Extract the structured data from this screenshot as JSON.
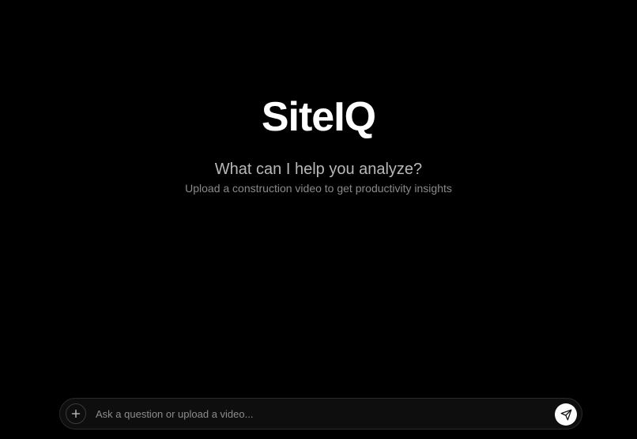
{
  "brand": {
    "name": "SiteIQ"
  },
  "welcome": {
    "headline": "What can I help you analyze?",
    "subline": "Upload a construction video to get productivity insights"
  },
  "composer": {
    "placeholder": "Ask a question or upload a video...",
    "value": "",
    "attach_icon": "plus-icon",
    "send_icon": "send-icon"
  },
  "colors": {
    "background": "#000000",
    "composer_bg": "#0e0e0e",
    "send_button": "#ffffff"
  }
}
